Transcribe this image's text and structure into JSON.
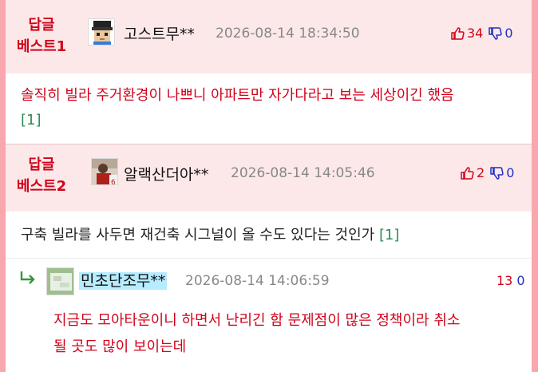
{
  "comments": [
    {
      "badge_line1": "답글",
      "badge_line2": "베스트1",
      "nickname": "고스트무**",
      "date": "2026-08-14 18:34:50",
      "upvotes": "34",
      "downvotes": "0",
      "body": "솔직히 빌라 주거환경이 나쁘니 아파트만 자가다라고 보는 세상이긴 했음",
      "reply_count": "[1]"
    },
    {
      "badge_line1": "답글",
      "badge_line2": "베스트2",
      "nickname": "알랙산더아**",
      "date": "2026-08-14 14:05:46",
      "upvotes": "2",
      "downvotes": "0",
      "body": "구축 빌라를 사두면 재건축 시그널이 올 수도 있다는 것인가",
      "reply_count": "[1]"
    }
  ],
  "reply": {
    "nickname": "민초단조무**",
    "date": "2026-08-14 14:06:59",
    "upvotes": "13",
    "downvotes": "0",
    "body_line1": "지금도 모아타운이니 하면서 난리긴 함 문제점이 많은 정책이라 취소",
    "body_line2": "될 곳도 많이 보이는데"
  },
  "colors": {
    "accent_red": "#d0021b",
    "down_blue": "#1f2fc4",
    "header_bg": "#fde8e9",
    "frame_pink": "#f7a7ad",
    "reply_count_green": "#2e8b57",
    "nick_highlight": "#b6ecff"
  }
}
